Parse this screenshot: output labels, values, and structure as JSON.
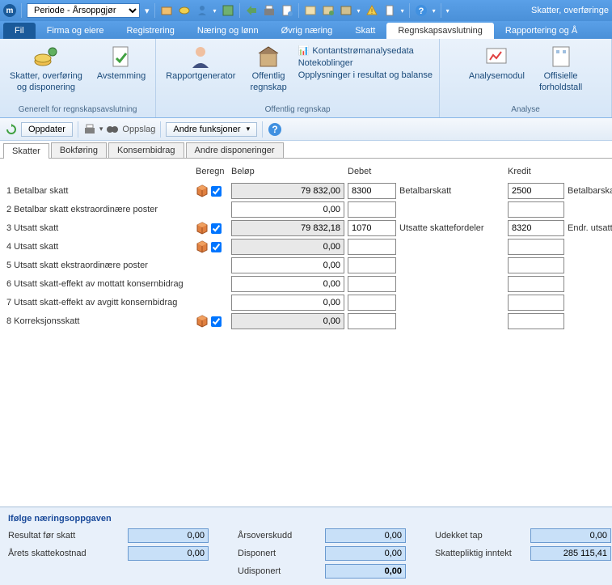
{
  "titlebar": {
    "period_select": "Periode - Årsoppgjør",
    "right_text": "Skatter, overføringe"
  },
  "tabs": {
    "fil": "Fil",
    "firma": "Firma og eiere",
    "registrering": "Registrering",
    "naering": "Næring og lønn",
    "ovrig": "Øvrig næring",
    "skatt": "Skatt",
    "regnskap": "Regnskapsavslutning",
    "rapportering": "Rapportering og Å"
  },
  "ribbon": {
    "group1": {
      "btn1_l1": "Skatter, overføring",
      "btn1_l2": "og disponering",
      "btn2": "Avstemming",
      "label": "Generelt for regnskapsavslutning"
    },
    "group2": {
      "btn1": "Rapportgenerator",
      "btn2_l1": "Offentlig",
      "btn2_l2": "regnskap",
      "link1": "Kontantstrømanalysedata",
      "link2": "Notekoblinger",
      "link3": "Opplysninger i resultat og balanse",
      "label": "Offentlig regnskap"
    },
    "group3": {
      "btn1": "Analysemodul",
      "btn2_l1": "Offisielle",
      "btn2_l2": "forholdstall",
      "label": "Analyse"
    }
  },
  "toolbar2": {
    "oppdater": "Oppdater",
    "oppslag": "Oppslag",
    "andre": "Andre funksjoner"
  },
  "subtabs": {
    "skatter": "Skatter",
    "bokforing": "Bokføring",
    "konsern": "Konsernbidrag",
    "andre": "Andre disponeringer"
  },
  "headers": {
    "beregn": "Beregn",
    "belop": "Beløp",
    "debet": "Debet",
    "kredit": "Kredit"
  },
  "rows": [
    {
      "label": "1 Betalbar skatt",
      "cube": true,
      "check": true,
      "gray": true,
      "belop": "79 832,00",
      "debet": "8300",
      "debet_desc": "Betalbarskatt",
      "kredit": "2500",
      "kredit_desc": "Betalbarskatt"
    },
    {
      "label": "2 Betalbar skatt ekstraordinære poster",
      "cube": false,
      "check": false,
      "gray": false,
      "belop": "0,00",
      "debet": "",
      "debet_desc": "",
      "kredit": "",
      "kredit_desc": ""
    },
    {
      "label": "3 Utsatt skatt",
      "cube": true,
      "check": true,
      "gray": true,
      "belop": "79 832,18",
      "debet": "1070",
      "debet_desc": "Utsatte skattefordeler",
      "kredit": "8320",
      "kredit_desc": "Endr. utsatt skatt"
    },
    {
      "label": "4 Utsatt skatt",
      "cube": true,
      "check": true,
      "gray": true,
      "belop": "0,00",
      "debet": "",
      "debet_desc": "",
      "kredit": "",
      "kredit_desc": ""
    },
    {
      "label": "5 Utsatt skatt ekstraordinære poster",
      "cube": false,
      "check": false,
      "gray": false,
      "belop": "0,00",
      "debet": "",
      "debet_desc": "",
      "kredit": "",
      "kredit_desc": ""
    },
    {
      "label": "6 Utsatt skatt-effekt av mottatt konsernbidrag",
      "cube": false,
      "check": false,
      "gray": false,
      "belop": "0,00",
      "debet": "",
      "debet_desc": "",
      "kredit": "",
      "kredit_desc": ""
    },
    {
      "label": "7 Utsatt skatt-effekt av avgitt konsernbidrag",
      "cube": false,
      "check": false,
      "gray": false,
      "belop": "0,00",
      "debet": "",
      "debet_desc": "",
      "kredit": "",
      "kredit_desc": ""
    },
    {
      "label": "8 Korreksjonsskatt",
      "cube": true,
      "check": true,
      "gray": true,
      "belop": "0,00",
      "debet": "",
      "debet_desc": "",
      "kredit": "",
      "kredit_desc": ""
    }
  ],
  "bottom": {
    "title": "Ifølge næringsoppgaven",
    "resultat_lbl": "Resultat før skatt",
    "resultat_val": "0,00",
    "arets_lbl": "Årets skattekostnad",
    "arets_val": "0,00",
    "arsoverskudd_lbl": "Årsoverskudd",
    "arsoverskudd_val": "0,00",
    "disponert_lbl": "Disponert",
    "disponert_val": "0,00",
    "udisponert_lbl": "Udisponert",
    "udisponert_val": "0,00",
    "udekket_lbl": "Udekket tap",
    "udekket_val": "0,00",
    "skattepliktig_lbl": "Skattepliktig inntekt",
    "skattepliktig_val": "285 115,41"
  }
}
